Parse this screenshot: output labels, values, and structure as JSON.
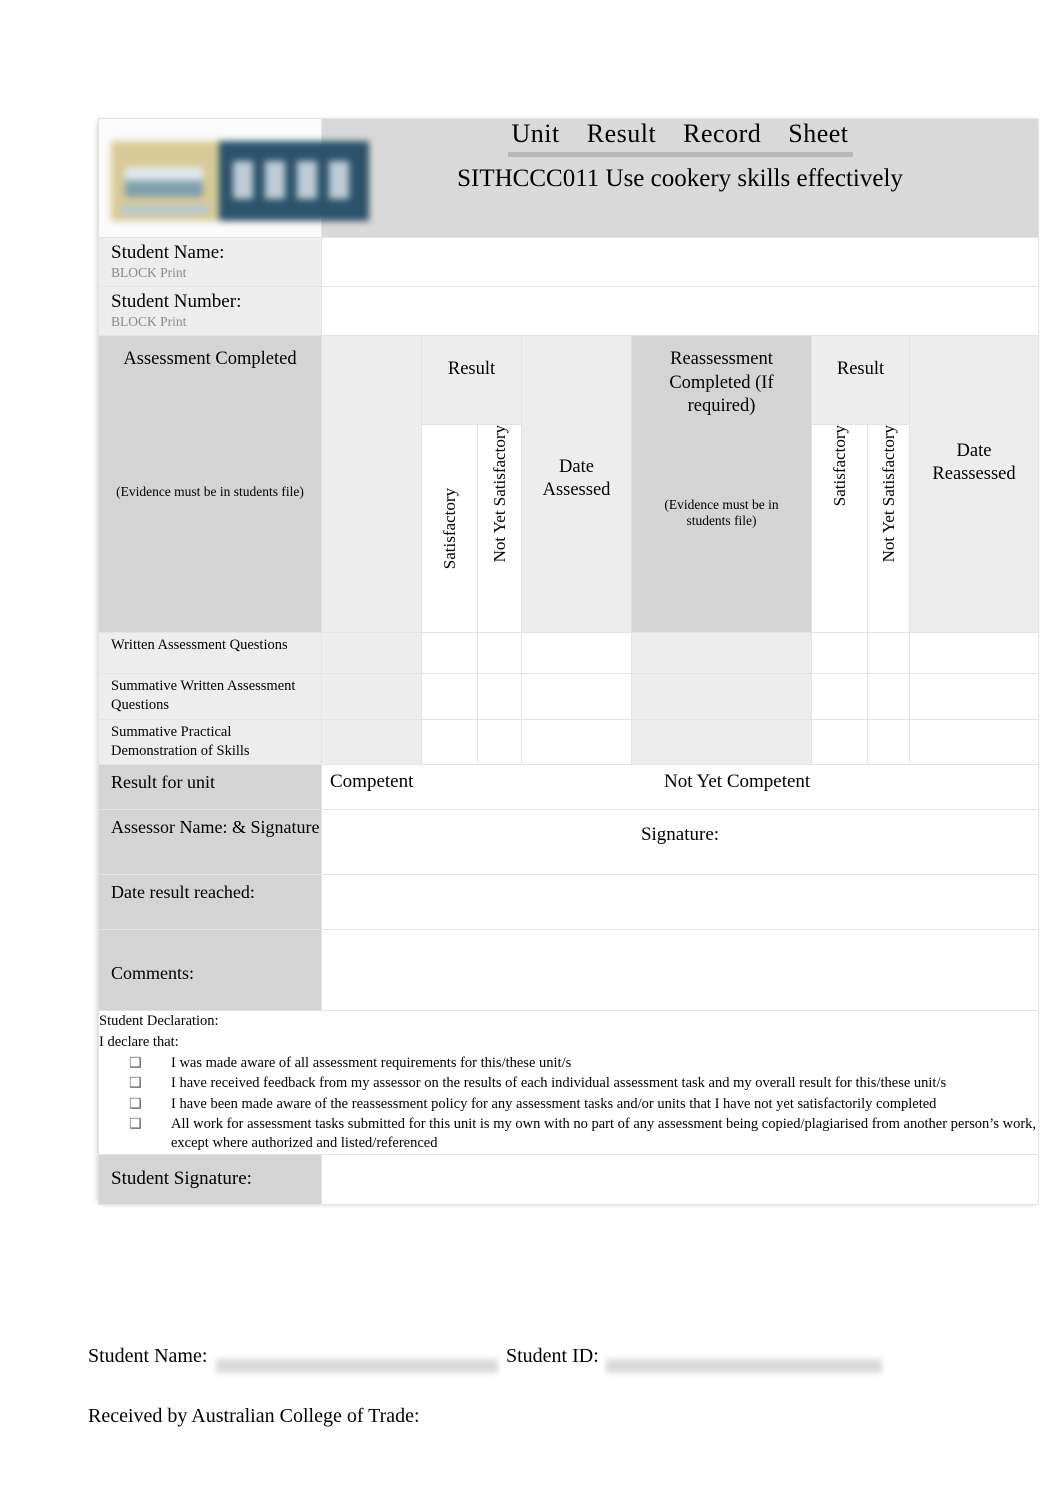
{
  "header": {
    "title_main": "Unit   Result   Record   Sheet",
    "title_sub": "SITHCCC011 Use cookery skills effectively",
    "logo_alt": "Australian College of Trade logo"
  },
  "student": {
    "name_label": "Student Name:",
    "name_hint": "BLOCK Print",
    "name_value": "",
    "number_label": "Student Number:",
    "number_hint": "BLOCK Print",
    "number_value": ""
  },
  "matrix": {
    "assessment_completed": "Assessment Completed",
    "assessment_note": "(Evidence must be in students file)",
    "result_1": "Result",
    "satisfactory_1": "Satisfactory",
    "not_yet_satisfactory_1": "Not Yet Satisfactory",
    "date_assessed": "Date Assessed",
    "reassessment_completed": "Reassessment Completed (If required)",
    "reassessment_note": "(Evidence must be in students file)",
    "result_2": "Result",
    "satisfactory_2": "Satisfactory",
    "not_yet_satisfactory_2": "Not Yet Satisfactory",
    "date_reassessed": "Date Reassessed",
    "rows": [
      {
        "task": "Written Assessment Questions",
        "satisfactory": "",
        "not_yet_satisfactory": "",
        "date_assessed": "",
        "re_satisfactory": "",
        "re_not_yet_satisfactory": "",
        "date_reassessed": "",
        "date_assessed_mark": false,
        "date_reassessed_mark": false
      },
      {
        "task": "Summative Written Assessment Questions",
        "satisfactory": "",
        "not_yet_satisfactory": "",
        "date_assessed": "",
        "re_satisfactory": "",
        "re_not_yet_satisfactory": "",
        "date_reassessed": "",
        "date_assessed_mark": false,
        "date_reassessed_mark": false
      },
      {
        "task": "Summative Practical Demonstration of Skills",
        "satisfactory": "",
        "not_yet_satisfactory": "",
        "date_assessed": "",
        "re_satisfactory": "",
        "re_not_yet_satisfactory": "",
        "date_reassessed": "",
        "date_assessed_mark": true,
        "date_reassessed_mark": true
      }
    ]
  },
  "result": {
    "label": "Result for unit",
    "competent": "Competent",
    "not_yet_competent": "Not Yet Competent"
  },
  "assessor": {
    "label": "Assessor Name: & Signature",
    "signature_label": "Signature:",
    "name_value": "",
    "signature_value": ""
  },
  "date_result": {
    "label": "Date result reached:",
    "value": ""
  },
  "comments": {
    "label": "Comments:",
    "value": ""
  },
  "declaration": {
    "heading": "Student Declaration:",
    "intro": "I declare that:",
    "bullet_glyph": "❑",
    "items": [
      "I was made aware of all assessment requirements for this/these unit/s",
      "I have received feedback from my assessor on the results of each individual assessment task and my overall result for this/these unit/s",
      "I have been made aware of the reassessment policy for any assessment tasks and/or units that I have not yet satisfactorily completed",
      "All work for assessment tasks submitted for this unit is my own with no part of any assessment being copied/plagiarised from another person’s work, except where authorized and listed/referenced"
    ]
  },
  "student_signature": {
    "label": "Student Signature:",
    "value": ""
  },
  "footer": {
    "student_name_label": "Student Name:",
    "student_name_value": "",
    "student_id_label": "Student ID:",
    "student_id_value": "",
    "received_label": "Received by Australian College of Trade:"
  },
  "colors": {
    "header_band": "#d9d9d9",
    "label_shade": "#d4d4d4",
    "light_shade": "#ededed",
    "border": "#e3e3e3"
  }
}
